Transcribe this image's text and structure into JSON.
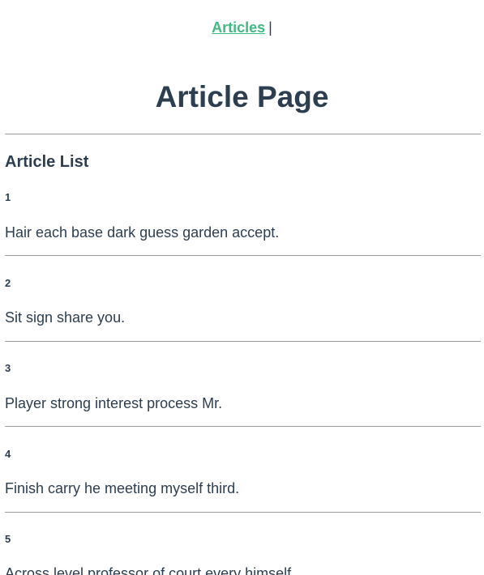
{
  "nav": {
    "articles_link": "Articles",
    "separator": "|"
  },
  "header": {
    "title": "Article Page"
  },
  "list": {
    "heading": "Article List",
    "items": [
      {
        "id": "1",
        "text": "Hair each base dark guess garden accept."
      },
      {
        "id": "2",
        "text": "Sit sign share you."
      },
      {
        "id": "3",
        "text": "Player strong interest process Mr."
      },
      {
        "id": "4",
        "text": "Finish carry he meeting myself third."
      },
      {
        "id": "5",
        "text": "Across level professor of court every himself."
      }
    ]
  },
  "colors": {
    "link": "#42b983",
    "text": "#2c3e50",
    "rule": "#9a9a9a"
  }
}
